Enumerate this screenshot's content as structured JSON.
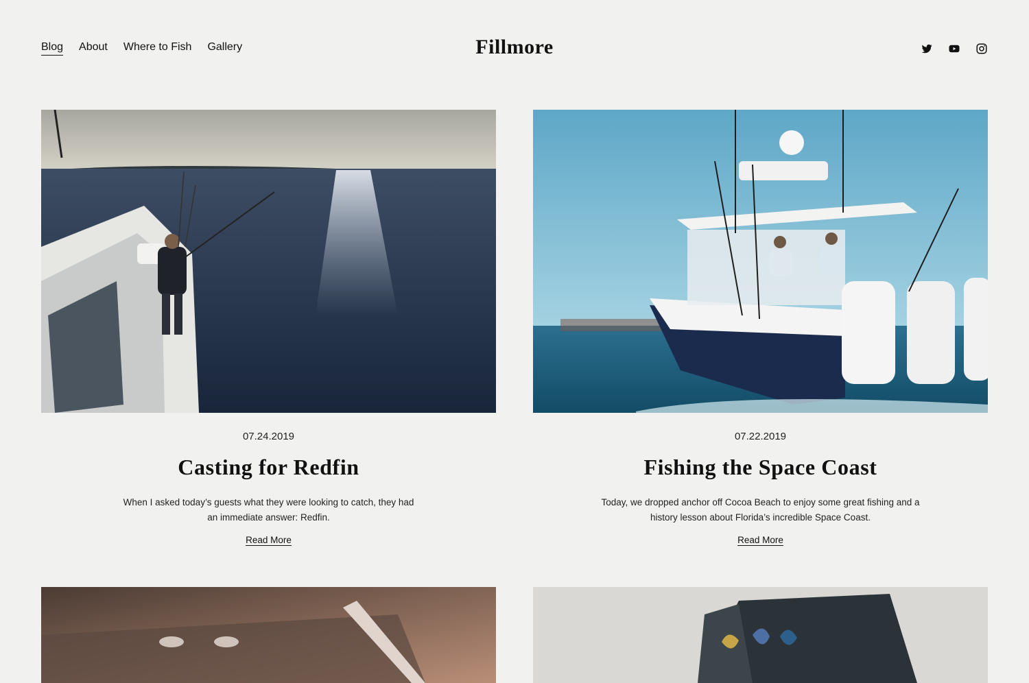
{
  "nav": {
    "items": [
      {
        "label": "Blog"
      },
      {
        "label": "About"
      },
      {
        "label": "Where to Fish"
      },
      {
        "label": "Gallery"
      }
    ]
  },
  "brand": {
    "name": "Fillmore"
  },
  "social": [
    "twitter-icon",
    "youtube-icon",
    "instagram-icon"
  ],
  "posts": [
    {
      "date": "07.24.2019",
      "title": "Casting for Redfin",
      "excerpt": "When I asked today’s guests what they were looking to catch, they had an immediate answer: Redfin.",
      "read_more": "Read More"
    },
    {
      "date": "07.22.2019",
      "title": "Fishing the Space Coast",
      "excerpt": "Today, we dropped anchor off Cocoa Beach to enjoy some great fishing and a history lesson about Florida’s incredible Space Coast.",
      "read_more": "Read More"
    }
  ],
  "colors": {
    "background": "#f1f1ef",
    "text": "#111111"
  }
}
